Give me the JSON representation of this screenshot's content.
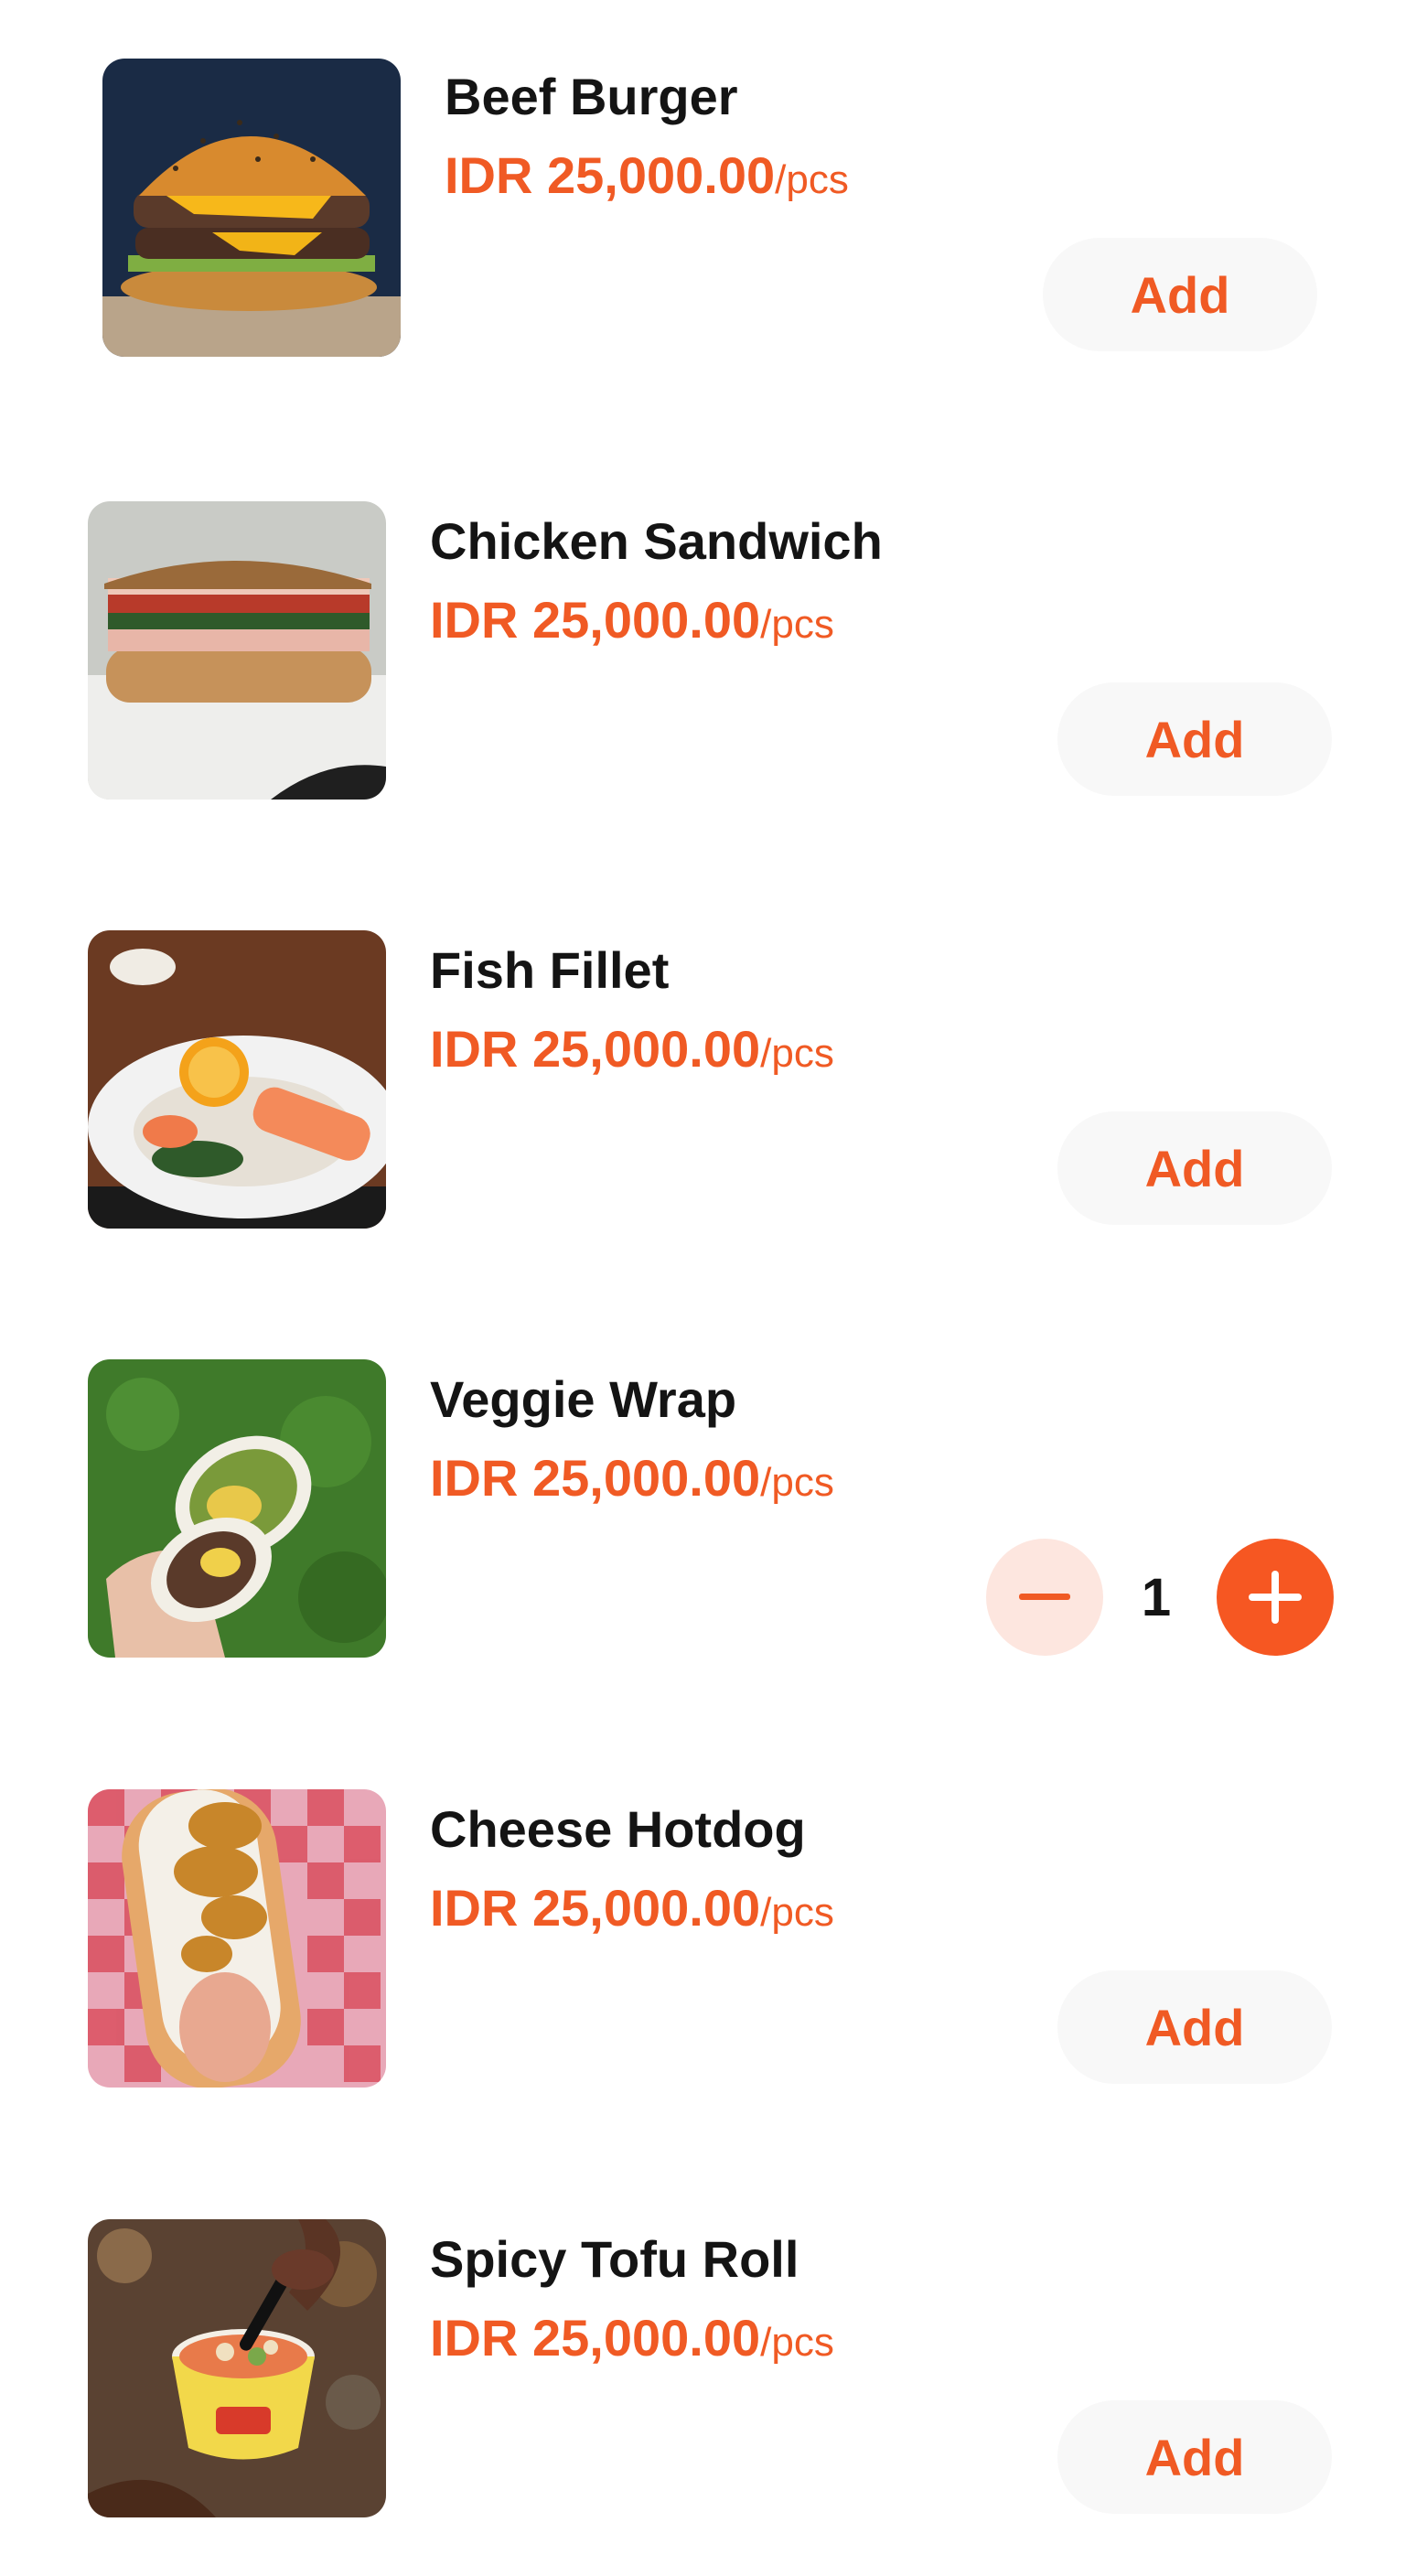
{
  "menu_items": [
    {
      "name": "Beef Burger",
      "price": "IDR 25,000.00",
      "unit": "/pcs",
      "action": "Add",
      "image_icon": "burger-image"
    },
    {
      "name": "Chicken Sandwich",
      "price": "IDR 25,000.00",
      "unit": "/pcs",
      "action": "Add",
      "image_icon": "sandwich-image"
    },
    {
      "name": "Fish Fillet",
      "price": "IDR 25,000.00",
      "unit": "/pcs",
      "action": "Add",
      "image_icon": "fish-fillet-image"
    },
    {
      "name": "Veggie Wrap",
      "price": "IDR 25,000.00",
      "unit": "/pcs",
      "quantity": "1",
      "image_icon": "wrap-image"
    },
    {
      "name": "Cheese Hotdog",
      "price": "IDR 25,000.00",
      "unit": "/pcs",
      "action": "Add",
      "image_icon": "hotdog-image"
    },
    {
      "name": "Spicy Tofu Roll",
      "price": "IDR 25,000.00",
      "unit": "/pcs",
      "action": "Add",
      "image_icon": "tofu-bowl-image"
    }
  ],
  "colors": {
    "accent": "#f05a24",
    "stepper_plus_bg": "#f65722",
    "stepper_minus_bg": "#fde6df",
    "add_button_bg": "#f8f8f8",
    "text_primary": "#141414"
  }
}
